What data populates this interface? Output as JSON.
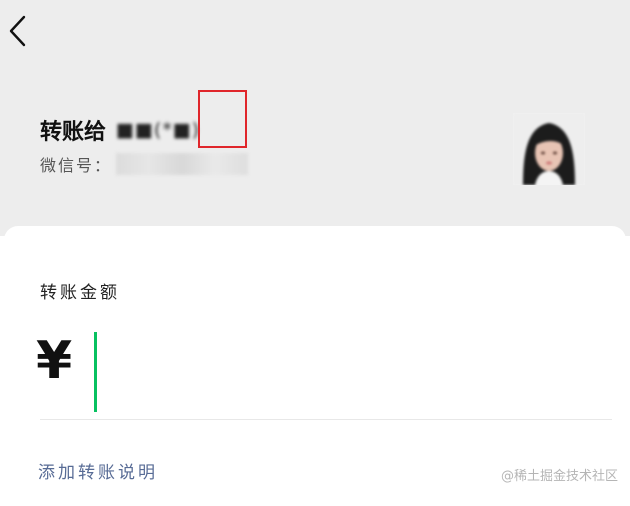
{
  "header": {
    "back_icon": "chevron-left-icon"
  },
  "recipient": {
    "title": "转账给",
    "masked_name": "■■(*■)",
    "wechat_id_label": "微信号：",
    "highlight_color": "#e0262b"
  },
  "transfer": {
    "amount_label": "转账金额",
    "currency_symbol": "¥",
    "amount_value": "",
    "caret_color": "#07c160",
    "add_note_label": "添加转账说明",
    "link_color": "#576b95"
  },
  "watermark": {
    "text": "@稀土掘金技术社区"
  }
}
